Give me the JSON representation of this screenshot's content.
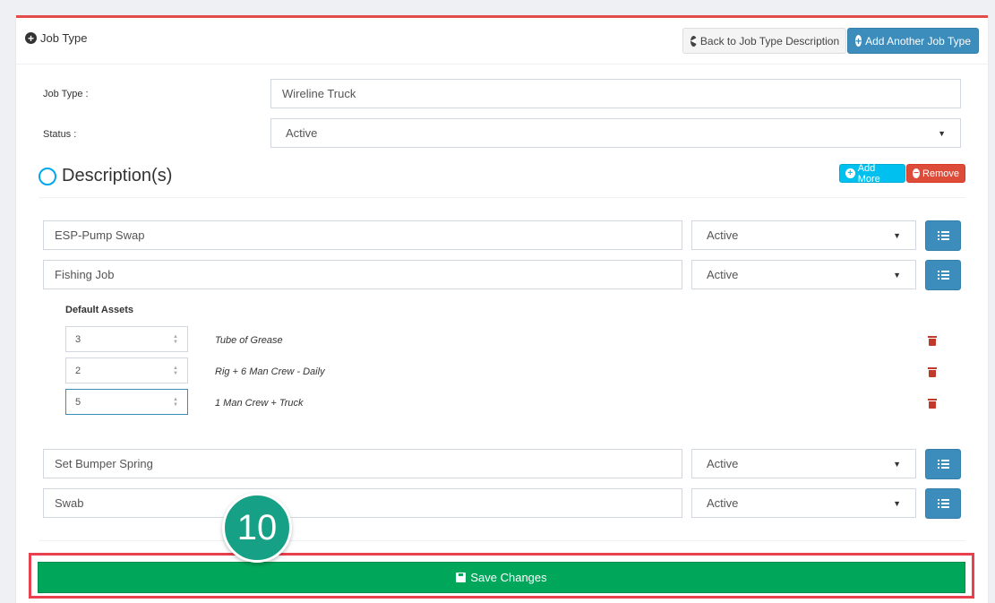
{
  "header": {
    "title": "Job Type",
    "back_label": "Back to Job Type Description",
    "add_label": "Add Another Job Type"
  },
  "form": {
    "job_type_label": "Job Type :",
    "job_type_value": "Wireline Truck",
    "status_label": "Status :",
    "status_value": "Active"
  },
  "descriptions": {
    "heading": "Description(s)",
    "add_more_label": "Add More",
    "remove_label": "Remove",
    "rows": [
      {
        "name": "ESP-Pump Swap",
        "status": "Active"
      },
      {
        "name": "Fishing Job",
        "status": "Active"
      },
      {
        "name": "Set Bumper Spring",
        "status": "Active"
      },
      {
        "name": "Swab",
        "status": "Active"
      }
    ]
  },
  "default_assets": {
    "title": "Default Assets",
    "items": [
      {
        "qty": "3",
        "name": "Tube of Grease"
      },
      {
        "qty": "2",
        "name": "Rig + 6 Man Crew - Daily"
      },
      {
        "qty": "5",
        "name": "1 Man Crew + Truck"
      }
    ]
  },
  "save_label": "Save Changes",
  "step_badge": "10",
  "colors": {
    "primary": "#3c8dbc",
    "success": "#00a65a",
    "danger": "#dd4b39",
    "info": "#00c0ef",
    "badge": "#16a085",
    "highlight": "#e8404f"
  }
}
